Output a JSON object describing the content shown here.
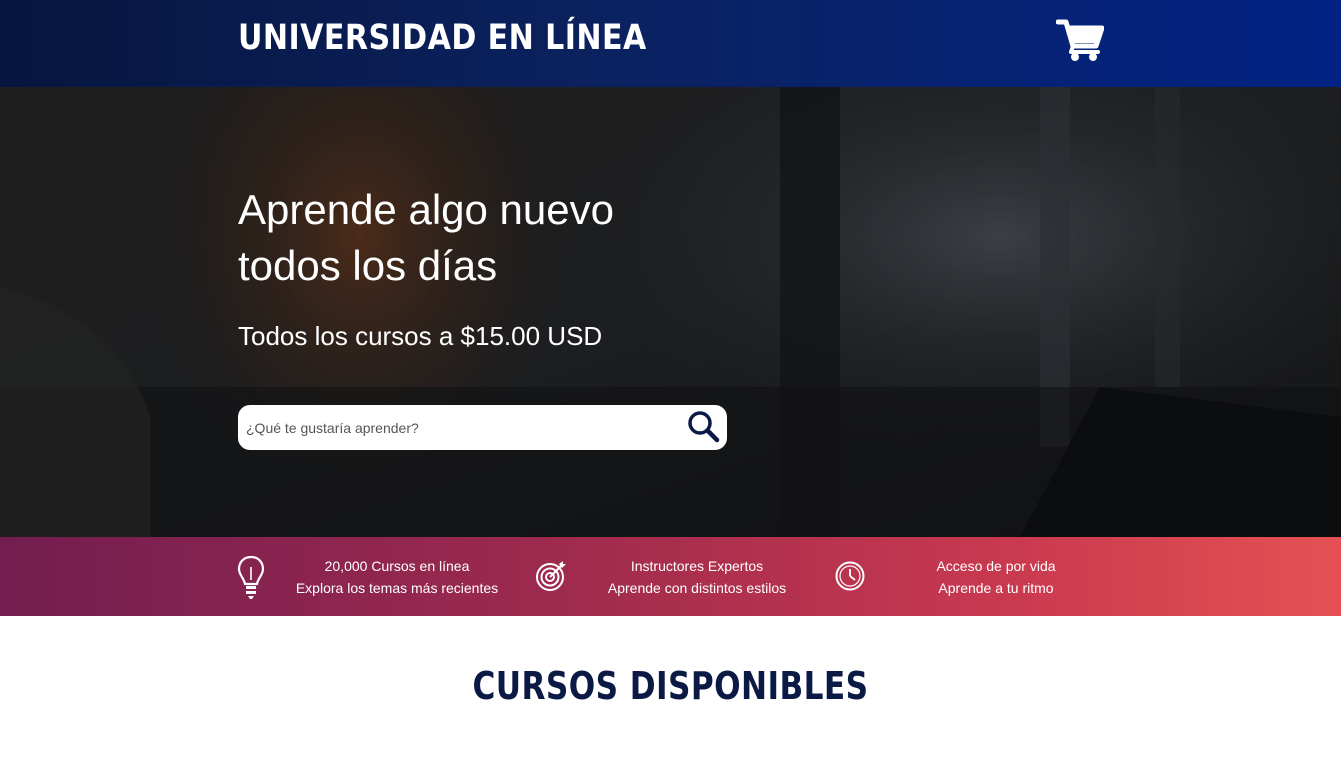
{
  "header": {
    "logo": "UNIVERSIDAD EN LÍNEA",
    "cart_icon": "shopping-cart-icon"
  },
  "hero": {
    "title_line1": "Aprende algo nuevo",
    "title_line2": "todos los días",
    "subtitle": "Todos los cursos a $15.00 USD",
    "search": {
      "placeholder": "¿Qué te gustaría aprender?",
      "value": "",
      "icon": "search-icon"
    }
  },
  "features": [
    {
      "icon": "lightbulb-icon",
      "title": "20,000 Cursos en línea",
      "subtitle": "Explora los temas más recientes"
    },
    {
      "icon": "target-icon",
      "title": "Instructores Expertos",
      "subtitle": "Aprende con distintos estilos"
    },
    {
      "icon": "clock-icon",
      "title": "Acceso de por vida",
      "subtitle": "Aprende a tu ritmo"
    }
  ],
  "section": {
    "title": "CURSOS DISPONIBLES"
  },
  "colors": {
    "header_start": "#07163f",
    "header_end": "#022384",
    "features_start": "#731d50",
    "features_end": "#e55153",
    "section_title": "#0b1a45"
  }
}
